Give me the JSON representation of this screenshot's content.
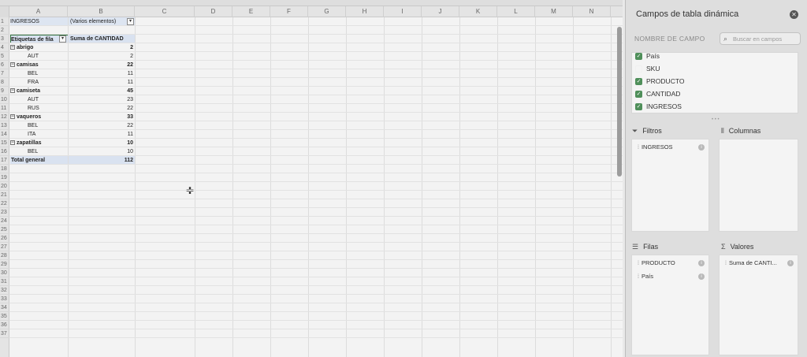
{
  "sheet": {
    "columns": [
      "A",
      "B",
      "C",
      "D",
      "E",
      "F",
      "G",
      "H",
      "I",
      "J",
      "K",
      "L",
      "M",
      "N"
    ],
    "rows": [
      "1",
      "2",
      "3",
      "4",
      "5",
      "6",
      "7",
      "8",
      "9",
      "10",
      "11",
      "12",
      "13",
      "14",
      "15",
      "16",
      "17",
      "18",
      "19",
      "20",
      "21",
      "22",
      "23",
      "24",
      "25",
      "26",
      "27",
      "28",
      "29",
      "30",
      "31",
      "32",
      "33",
      "34",
      "35",
      "36",
      "37"
    ],
    "filter_cell": {
      "label": "INGRESOS",
      "value": "(Varios elementos)"
    },
    "header": {
      "row_labels": "Etiquetas de fila",
      "sum_label": "Suma de CANTIDAD"
    },
    "pivot_rows": [
      {
        "label": "abrigo",
        "value": "2",
        "level": 0
      },
      {
        "label": "AUT",
        "value": "2",
        "level": 1
      },
      {
        "label": "camisas",
        "value": "22",
        "level": 0
      },
      {
        "label": "BEL",
        "value": "11",
        "level": 1
      },
      {
        "label": "FRA",
        "value": "11",
        "level": 1
      },
      {
        "label": "camiseta",
        "value": "45",
        "level": 0
      },
      {
        "label": "AUT",
        "value": "23",
        "level": 1
      },
      {
        "label": "RUS",
        "value": "22",
        "level": 1
      },
      {
        "label": "vaqueros",
        "value": "33",
        "level": 0
      },
      {
        "label": "BEL",
        "value": "22",
        "level": 1
      },
      {
        "label": "ITA",
        "value": "11",
        "level": 1
      },
      {
        "label": "zapatillas",
        "value": "10",
        "level": 0
      },
      {
        "label": "BEL",
        "value": "10",
        "level": 1
      }
    ],
    "total": {
      "label": "Total general",
      "value": "112"
    }
  },
  "panel": {
    "title": "Campos de tabla dinámica",
    "field_name_label": "NOMBRE DE CAMPO",
    "search_placeholder": "Buscar en campos",
    "fields": [
      {
        "name": "País",
        "checked": true
      },
      {
        "name": "SKU",
        "checked": false
      },
      {
        "name": "PRODUCTO",
        "checked": true
      },
      {
        "name": "CANTIDAD",
        "checked": true
      },
      {
        "name": "INGRESOS",
        "checked": true
      }
    ],
    "areas": {
      "filters": {
        "title": "Filtros",
        "items": [
          "INGRESOS"
        ]
      },
      "columns": {
        "title": "Columnas",
        "items": []
      },
      "rows": {
        "title": "Filas",
        "items": [
          "PRODUCTO",
          "País"
        ]
      },
      "values": {
        "title": "Valores",
        "items": [
          "Suma de CANTI..."
        ]
      }
    },
    "icons": {
      "filters": "funnel-icon",
      "columns": "columns-icon",
      "rows": "rows-icon",
      "values": "sigma-icon"
    }
  },
  "colors": {
    "pivot_header": "#d9e2f0",
    "checkbox": "#4f8f5a"
  }
}
